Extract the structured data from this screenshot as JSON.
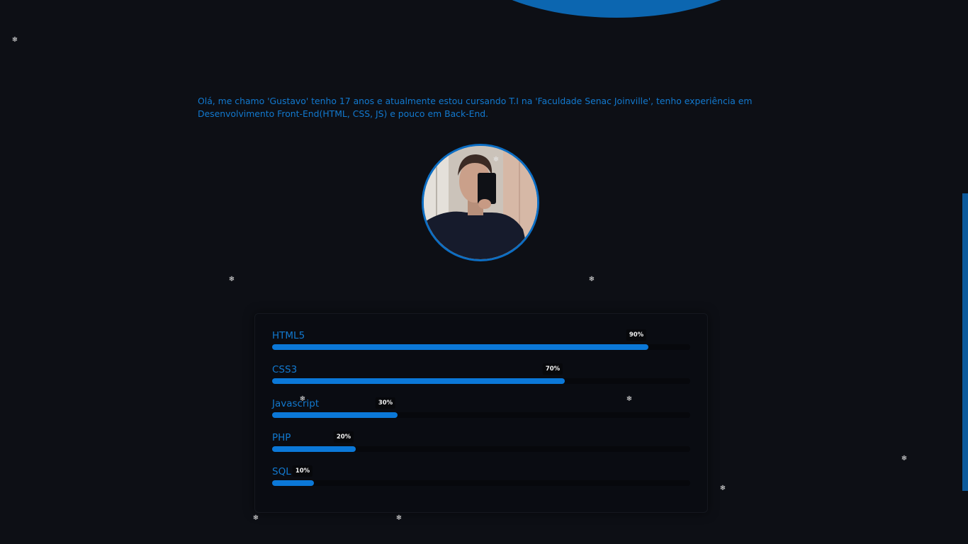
{
  "intro": {
    "text": "Olá, me chamo 'Gustavo' tenho 17 anos e atualmente estou cursando T.I na 'Faculdade Senac Joinville', tenho experiência em Desenvolvimento Front-End(HTML, CSS, JS) e pouco em Back-End."
  },
  "skills": [
    {
      "name": "HTML5",
      "percent_label": "90%",
      "level": 0.9
    },
    {
      "name": "CSS3",
      "percent_label": "70%",
      "level": 0.7
    },
    {
      "name": "Javascript",
      "percent_label": "30%",
      "level": 0.3
    },
    {
      "name": "PHP",
      "percent_label": "20%",
      "level": 0.2
    },
    {
      "name": "SQL",
      "percent_label": "10%",
      "level": 0.1
    }
  ],
  "colors": {
    "background": "#0d0f15",
    "accent": "#0b78d8",
    "text_accent": "#1279cf"
  },
  "icons": {
    "snowflake": "snowflake-icon",
    "avatar": "profile-photo"
  }
}
